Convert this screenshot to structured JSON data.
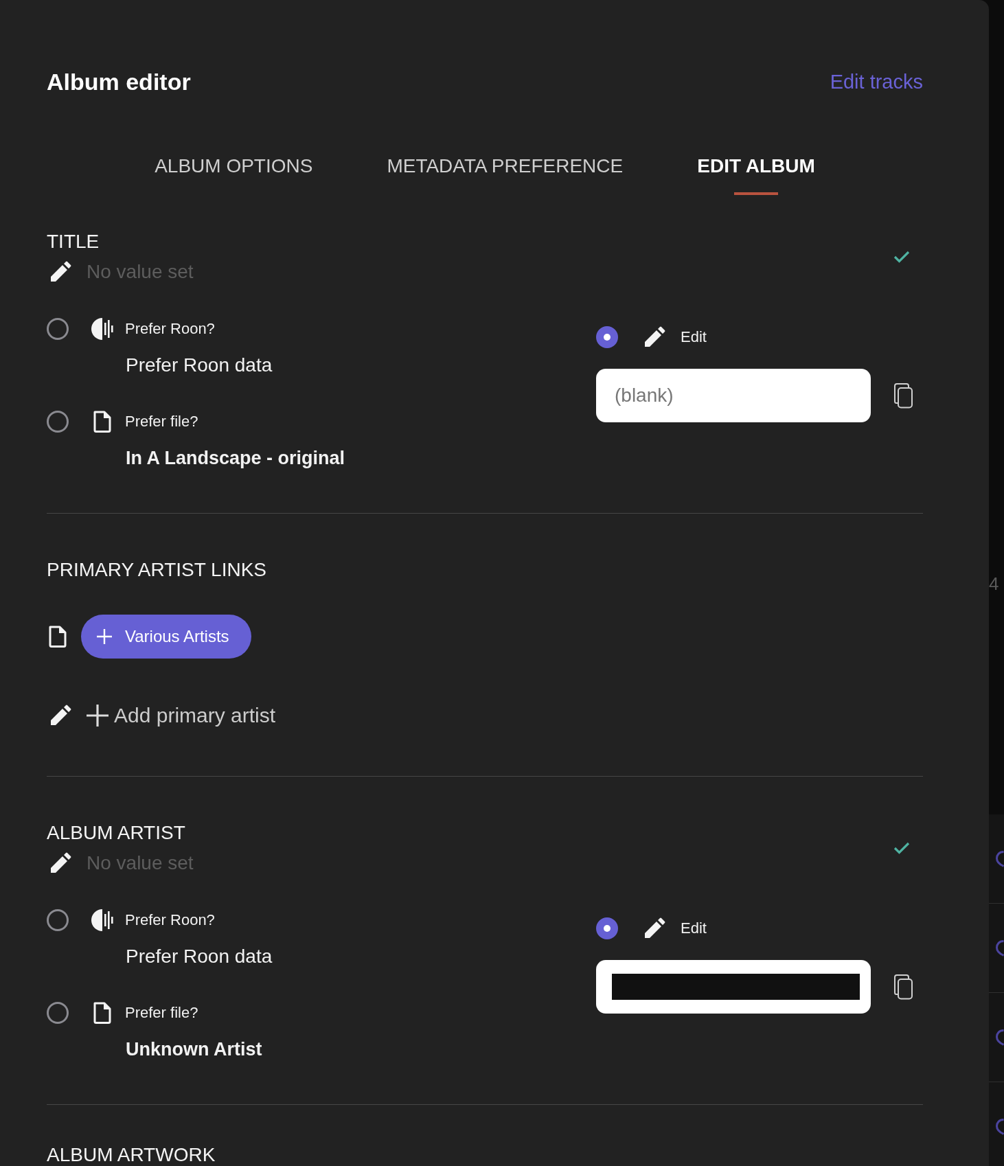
{
  "header": {
    "title": "Album editor",
    "link": "Edit tracks"
  },
  "tabs": [
    {
      "label": "ALBUM OPTIONS",
      "selected": false
    },
    {
      "label": "METADATA PREFERENCE",
      "selected": false
    },
    {
      "label": "EDIT ALBUM",
      "selected": true
    }
  ],
  "sections": [
    {
      "kind": "choice",
      "heading": "TITLE",
      "current": {
        "value": "No value set",
        "set": false
      },
      "confirmed": true,
      "options": [
        {
          "kind": "roon",
          "label": "Prefer Roon?",
          "value": "Prefer Roon data",
          "selected": false
        },
        {
          "kind": "file",
          "label": "Prefer file?",
          "value": "In A Landscape - original",
          "selected": false
        }
      ],
      "edit": {
        "label": "Edit",
        "selected": true,
        "placeholder": "(blank)"
      }
    },
    {
      "kind": "links",
      "heading": "PRIMARY ARTIST LINKS",
      "links": [
        {
          "kind": "file",
          "label": "Various Artists"
        }
      ],
      "add": {
        "kind": "edit",
        "label": "Add primary artist"
      }
    },
    {
      "kind": "choice",
      "heading": "ALBUM ARTIST",
      "current": {
        "value": "No value set",
        "set": false
      },
      "confirmed": true,
      "options": [
        {
          "kind": "roon",
          "label": "Prefer Roon?",
          "value": "Prefer Roon data",
          "selected": false
        },
        {
          "kind": "file",
          "label": "Prefer file?",
          "value": "Unknown Artist",
          "selected": false
        }
      ],
      "edit": {
        "label": "Edit",
        "selected": true,
        "redacted": true
      }
    },
    {
      "kind": "heading",
      "heading": "ALBUM ARTWORK"
    }
  ],
  "backdrop": {
    "text": "4"
  }
}
